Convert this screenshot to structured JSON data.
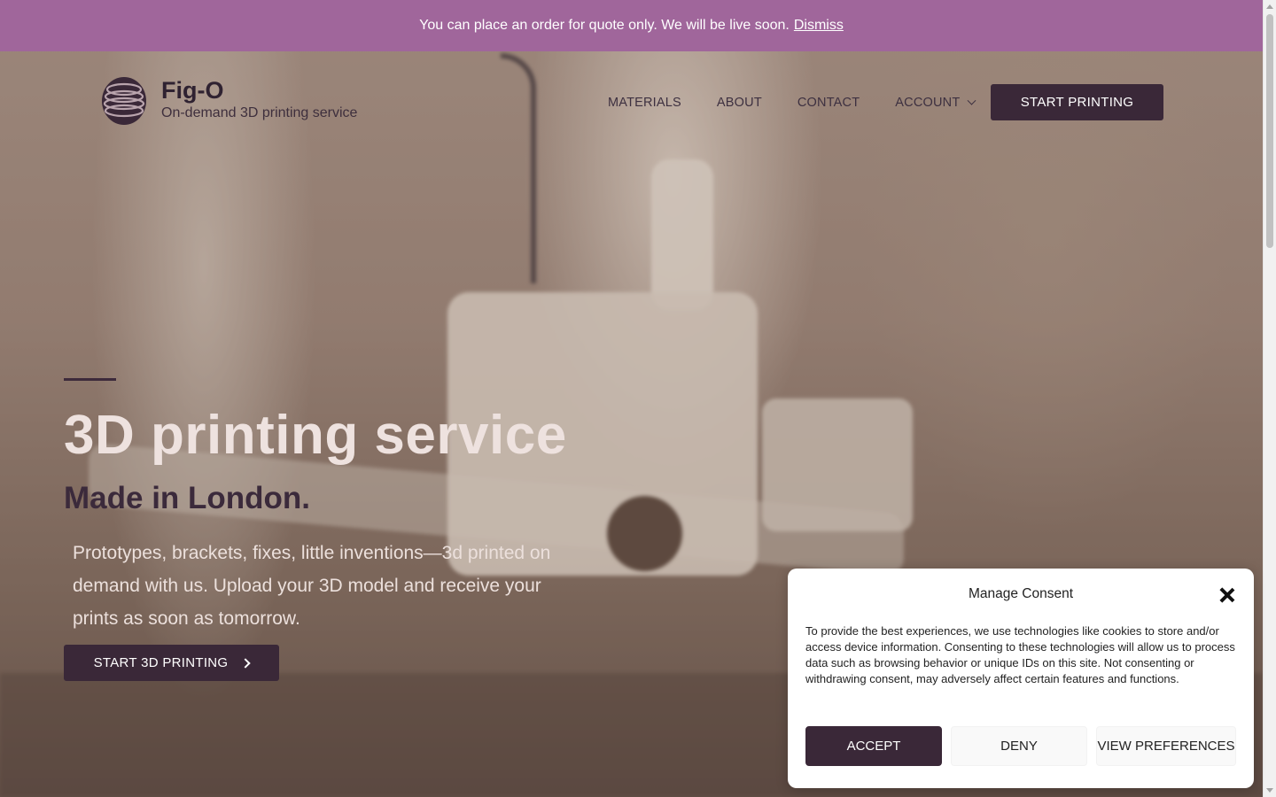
{
  "notice": {
    "text": "You can place an order for quote only. We will be live soon.",
    "dismiss_label": "Dismiss"
  },
  "header": {
    "brand_name": "Fig-O",
    "tagline": "On-demand 3D printing service",
    "nav": [
      {
        "label": "MATERIALS"
      },
      {
        "label": "ABOUT"
      },
      {
        "label": "CONTACT"
      },
      {
        "label": "ACCOUNT"
      }
    ],
    "cta_label": "START PRINTING"
  },
  "hero": {
    "title": "3D printing service",
    "subtitle": "Made in London.",
    "description": "Prototypes, brackets, fixes, little inventions—3d printed on demand with us. Upload your 3D model and receive your prints as soon as tomorrow.",
    "cta_label": "START 3D PRINTING"
  },
  "consent": {
    "title": "Manage Consent",
    "body": "To provide the best experiences, we use technologies like cookies to store and/or access device information. Consenting to these technologies will allow us to process data such as browsing behavior or unique IDs on this site. Not consenting or withdrawing consent, may adversely affect certain features and functions.",
    "accept_label": "ACCEPT",
    "deny_label": "DENY",
    "preferences_label": "VIEW PREFERENCES"
  },
  "colors": {
    "notice_bg": "#a0669b",
    "primary": "#3a2838",
    "hero_title": "#eee2df"
  },
  "icons": {
    "logo": "stacked-rings-logo-icon",
    "account_dropdown": "chevron-down-icon",
    "cta_arrow": "chevron-right-icon",
    "close": "close-icon"
  }
}
